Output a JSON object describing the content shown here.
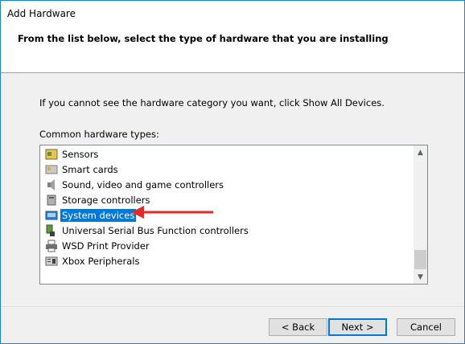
{
  "window": {
    "title": "Add Hardware"
  },
  "header": {
    "text": "From the list below, select the type of hardware that you are installing"
  },
  "instructions": "If you cannot see the hardware category you want, click Show All Devices.",
  "list": {
    "label": "Common hardware types:",
    "items": [
      {
        "label": "Sensors",
        "icon": "sensor-icon",
        "selected": false
      },
      {
        "label": "Smart cards",
        "icon": "smart-card-icon",
        "selected": false
      },
      {
        "label": "Sound, video and game controllers",
        "icon": "speaker-icon",
        "selected": false
      },
      {
        "label": "Storage controllers",
        "icon": "storage-controller-icon",
        "selected": false
      },
      {
        "label": "System devices",
        "icon": "system-devices-icon",
        "selected": true
      },
      {
        "label": "Universal Serial Bus Function controllers",
        "icon": "usb-icon",
        "selected": false
      },
      {
        "label": "WSD Print Provider",
        "icon": "printer-icon",
        "selected": false
      },
      {
        "label": "Xbox Peripherals",
        "icon": "gamepad-icon",
        "selected": false
      }
    ]
  },
  "buttons": {
    "back": "< Back",
    "next": "Next >",
    "cancel": "Cancel"
  },
  "colors": {
    "selection": "#0078d7",
    "annotation_arrow": "#e02b2b"
  }
}
